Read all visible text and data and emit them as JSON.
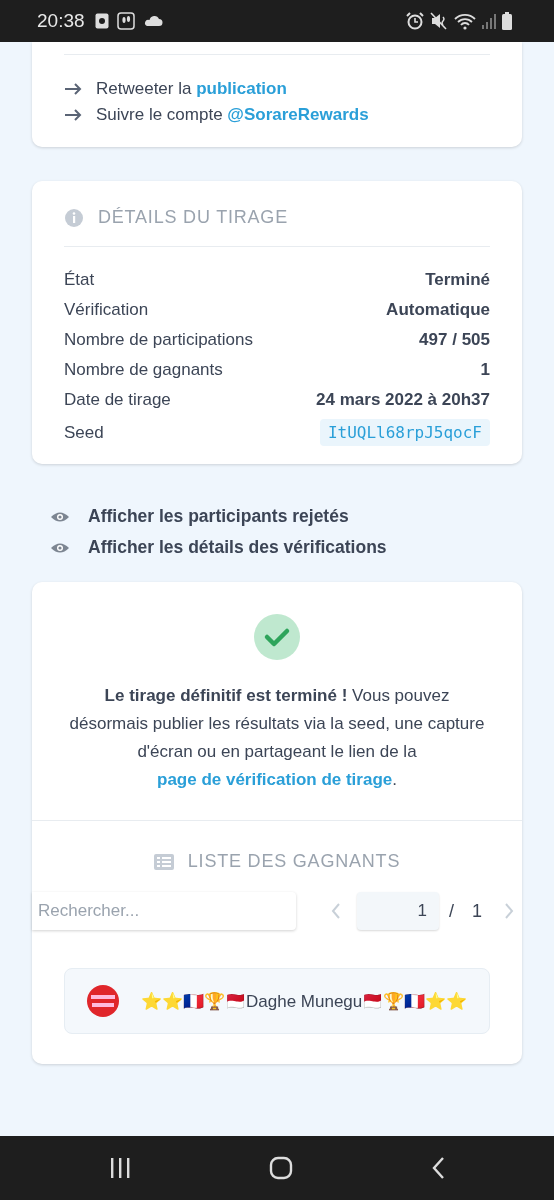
{
  "status_bar": {
    "time": "20:38"
  },
  "actions": {
    "items": [
      {
        "text": "Retweeter la ",
        "link": "publication"
      },
      {
        "text": "Suivre le compte ",
        "link": "@SorareRewards"
      }
    ]
  },
  "details": {
    "title": "DÉTAILS DU TIRAGE",
    "rows": [
      {
        "label": "État",
        "value": "Terminé",
        "kind": "text"
      },
      {
        "label": "Vérification",
        "value": "Automatique",
        "kind": "text"
      },
      {
        "label": "Nombre de participations",
        "value": "497 / 505",
        "kind": "text"
      },
      {
        "label": "Nombre de gagnants",
        "value": "1",
        "kind": "text"
      },
      {
        "label": "Date de tirage",
        "value": "24 mars 2022 à 20h37",
        "kind": "text"
      },
      {
        "label": "Seed",
        "value": "ItUQLl68rpJ5qocF",
        "kind": "code"
      }
    ]
  },
  "toggles": [
    {
      "label": "Afficher les participants rejetés"
    },
    {
      "label": "Afficher les détails des vérifications"
    }
  ],
  "result": {
    "message": "**Le tirage définitif est terminé !** Vous pouvez désormais publier les résultats via la seed, une capture d'écran ou en partageant le lien de la ",
    "link": "page de vérification de tirage",
    "end": ".",
    "winners_title": "LISTE DES GAGNANTS",
    "search": {
      "placeholder": "Rechercher..."
    },
    "pagination": {
      "page": "1",
      "separator": "/",
      "total": "1"
    },
    "winners": [
      {
        "name": "⭐⭐🇫🇷🏆🇲🇨Daghe Munegu🇲🇨🏆🇫🇷⭐⭐"
      }
    ]
  }
}
